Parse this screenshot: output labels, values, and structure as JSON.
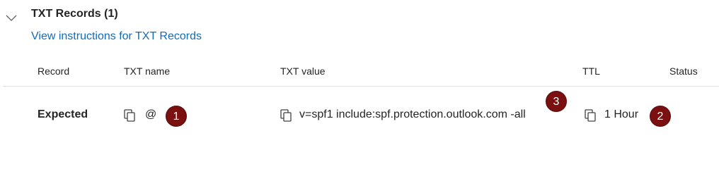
{
  "section": {
    "title": "TXT Records (1)",
    "instructions_link": "View instructions for TXT Records"
  },
  "table": {
    "headers": [
      "Record",
      "TXT name",
      "TXT value",
      "TTL",
      "Status"
    ],
    "row": {
      "record": "Expected",
      "txt_name": "@",
      "txt_value": "v=spf1 include:spf.protection.outlook.com -all",
      "ttl": "1 Hour",
      "status": ""
    }
  },
  "annotations": [
    "1",
    "2",
    "3"
  ],
  "colors": {
    "link": "#0f6cbd",
    "badge": "#7a1010",
    "text": "#242424",
    "divider": "#e1e1e1"
  },
  "icons": {
    "collapse": "chevron-down-icon",
    "copy": "copy-icon"
  }
}
